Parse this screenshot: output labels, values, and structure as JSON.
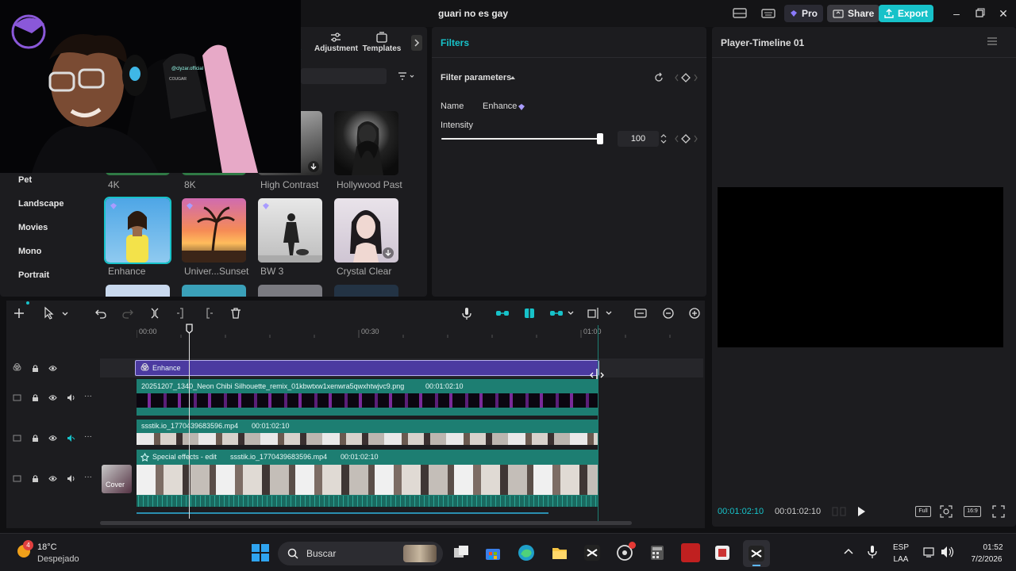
{
  "window": {
    "title": "guari no es gay"
  },
  "header": {
    "pro_label": "Pro",
    "share_label": "Share",
    "export_label": "Export"
  },
  "webcam": {
    "watermark": "@clyzar.official",
    "chair_text": "COUGAR"
  },
  "left_panel": {
    "tabs": [
      {
        "label": "s"
      },
      {
        "label": "Adjustment"
      },
      {
        "label": "Templates"
      }
    ],
    "categories": [
      "Pet",
      "Landscape",
      "Movies",
      "Mono",
      "Portrait"
    ],
    "row1": [
      "4K",
      "8K",
      "High Contrast",
      "Hollywood Past"
    ],
    "row2": [
      "Enhance",
      "Univer...Sunset",
      "BW 3",
      "Crystal Clear"
    ]
  },
  "filters": {
    "tab_label": "Filters",
    "section_title": "Filter parameters",
    "name_label": "Name",
    "name_value": "Enhance",
    "intensity_label": "Intensity",
    "intensity_value": "100",
    "intensity_fraction": 1.0
  },
  "player": {
    "title": "Player-Timeline 01",
    "current_time": "00:01:02:10",
    "total_time": "00:01:02:10",
    "full_label": "Full",
    "ratio_label": "16:9"
  },
  "timeline": {
    "ruler": [
      "00:00",
      "00:30",
      "01:00"
    ],
    "tracks": {
      "filter_clip": "Enhance",
      "overlay_clip": {
        "name": "20251207_1340_Neon Chibi Silhouette_remix_01kbwtxw1xenwra5qwxhtwjvc9.png",
        "duration": "00:01:02:10"
      },
      "video2_clip": {
        "name": "ssstik.io_1770439683596.mp4",
        "duration": "00:01:02:10"
      },
      "main_clip": {
        "effect": "Special effects - edit",
        "name": "ssstik.io_1770439683596.mp4",
        "duration": "00:01:02:10"
      },
      "cover_label": "Cover"
    }
  },
  "taskbar": {
    "weather_temp": "18°C",
    "weather_desc": "Despejado",
    "weather_badge": "4",
    "search_placeholder": "Buscar",
    "lang_top": "ESP",
    "lang_bottom": "LAA",
    "time": "01:52",
    "date": "7/2/2026"
  },
  "colors": {
    "accent": "#17c2c9",
    "filter_clip": "#4b3aa0",
    "track_teal": "#1d7e72",
    "panel": "#1c1c1f"
  }
}
